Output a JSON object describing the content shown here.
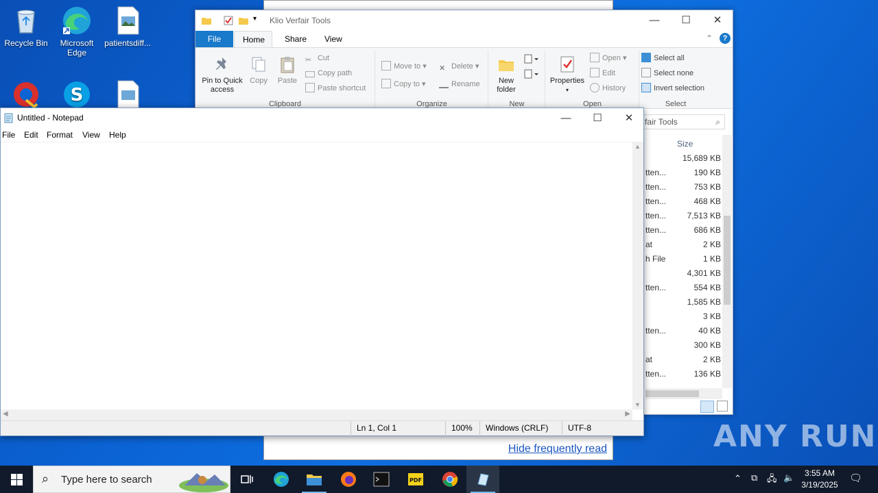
{
  "desktop": {
    "icons": [
      {
        "label": "Recycle Bin"
      },
      {
        "label": "Microsoft Edge"
      },
      {
        "label": "patientsdiff..."
      },
      {
        "label": ""
      },
      {
        "label": ""
      },
      {
        "label": ""
      }
    ]
  },
  "background_window": {
    "link": "Hide frequently read"
  },
  "explorer": {
    "title": "Klio Verfair Tools",
    "tabs": {
      "file": "File",
      "home": "Home",
      "share": "Share",
      "view": "View"
    },
    "clipboard": {
      "pin": "Pin to Quick access",
      "copy": "Copy",
      "paste": "Paste",
      "cut": "Cut",
      "copy_path": "Copy path",
      "paste_shortcut": "Paste shortcut",
      "label": "Clipboard"
    },
    "organize": {
      "move_to": "Move to",
      "copy_to": "Copy to",
      "delete": "Delete",
      "rename": "Rename",
      "label": "Organize"
    },
    "new": {
      "new_folder": "New folder",
      "label": "New"
    },
    "open": {
      "properties": "Properties",
      "open": "Open",
      "edit": "Edit",
      "history": "History",
      "label": "Open"
    },
    "select": {
      "select_all": "Select all",
      "select_none": "Select none",
      "invert": "Invert selection",
      "label": "Select"
    },
    "search_text": "fair Tools",
    "size_header": "Size",
    "rows": [
      {
        "type": "",
        "size": "15,689 KB"
      },
      {
        "type": "tten...",
        "size": "190 KB"
      },
      {
        "type": "tten...",
        "size": "753 KB"
      },
      {
        "type": "tten...",
        "size": "468 KB"
      },
      {
        "type": "tten...",
        "size": "7,513 KB"
      },
      {
        "type": "tten...",
        "size": "686 KB"
      },
      {
        "type": "at",
        "size": "2 KB"
      },
      {
        "type": "h File",
        "size": "1 KB"
      },
      {
        "type": "",
        "size": "4,301 KB"
      },
      {
        "type": "tten...",
        "size": "554 KB"
      },
      {
        "type": "",
        "size": "1,585 KB"
      },
      {
        "type": "",
        "size": "3 KB"
      },
      {
        "type": "tten...",
        "size": "40 KB"
      },
      {
        "type": "",
        "size": "300 KB"
      },
      {
        "type": "at",
        "size": "2 KB"
      },
      {
        "type": "tten...",
        "size": "136 KB"
      }
    ]
  },
  "notepad": {
    "title": "Untitled - Notepad",
    "menu": {
      "file": "File",
      "edit": "Edit",
      "format": "Format",
      "view": "View",
      "help": "Help"
    },
    "content": "",
    "status": {
      "position": "Ln 1, Col 1",
      "zoom": "100%",
      "line_endings": "Windows (CRLF)",
      "encoding": "UTF-8"
    }
  },
  "watermark": "ANY RUN",
  "taskbar": {
    "search_placeholder": "Type here to search",
    "time": "3:55 AM",
    "date": "3/19/2025"
  },
  "colors": {
    "desktop": "#0b63d4",
    "taskbar": "#101a2b",
    "accent": "#1979ca"
  }
}
